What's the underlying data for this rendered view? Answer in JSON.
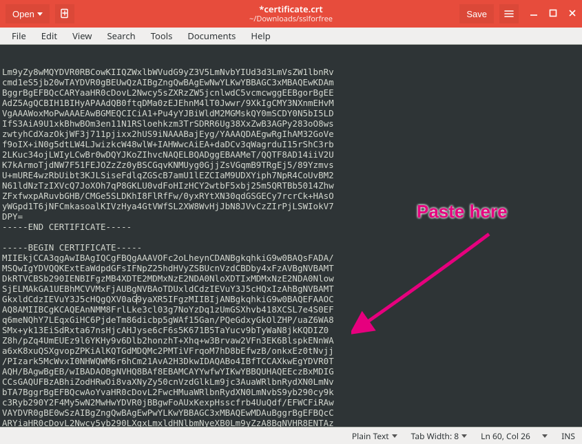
{
  "titlebar": {
    "open": "Open",
    "new_doc_title": "Create a new document",
    "save": "Save",
    "title": "*certificate.crt",
    "subtitle": "~/Downloads/sslforfree"
  },
  "menubar": {
    "file": "File",
    "edit": "Edit",
    "view": "View",
    "search": "Search",
    "tools": "Tools",
    "documents": "Documents",
    "help": "Help"
  },
  "editor": {
    "lines": [
      "Lm9yZy8wMQYDVR0RBCowKIIQZWxlbWVudG9yZ3V5LmNvbYIUd3d3LmVsZW1lbnRv",
      "cmd1eS5jb20wTAYDVR0gBEUwQzAIBgZngQwBAgEwNwYLKwYBBAGC3xMBAQEwKDAm",
      "BggrBgEFBQcCARYaaHR0cDovL2Nwcy5sZXRzZW5jcnlwdC5vcmcwggEEBgorBgEE",
      "AdZ5AgQCBIH1BIHyAPAAdQB0ftqDMa0zEJEhnM4lT0Jwwr/9XkIgCMY3NXnmEHvM",
      "VgAAAWoxMoPwAAAEAwBGMEQCICiA1+Pu4yYJBiWldM2MGMskQY0mSCDY0N5bI5LD",
      "IfS3AiA9U1xkBhwBOm3en11N1RSloehkzm3TrSDRR6Ug38XxZwB3AGPy283oO8ws",
      "zwtyhCdXazOkjWF3j711pjixx2hUS9iNAAABajEyg/YAAAQDAEgwRgIhAM32GoVe",
      "f9oIX+iN0g5dtLW4LJwizkcW48wlW+IAHWwcAiEA+daDCv3qWagrduI15rShC3rb",
      "2LKuc34ojLWIyLCwBr0wDQYJKoZIhvcNAQELBQADggEBAAMeT/QQTF8AD14iiV2U",
      "K7kArmoTjdNW7F51FEJOZzZz0yBSCGqvKNMUyg0GjjZsVGqmB9TRgEj5/89Yzmvs",
      "U+mURE4wzRbUibt3KJLSiseFdlqZGScB7amU1lEZCIaM9UDXYiph7NpR4CoUvBM2",
      "N61ldNzTzIXVcQ7JoXOh7qP8GKLU0vdFoHIzHCY2wtbF5xbj25m5QRTBb5014Zhw",
      "ZFxfwxpARuvbGHB/CMGe5SLDKhI8FlRfFw/0yxRYtXN30qdGSGECy7rcrCk+HAsO",
      "yWGpd1T6jNFCmkasoalKIVzHya4GtVWfSL2XW8WvHjJbN8JVvCzZIrPjLSWIokV7",
      "DPY=",
      "-----END CERTIFICATE-----",
      "",
      "-----BEGIN CERTIFICATE-----",
      "MIIEkjCCA3qgAwIBAgIQCgFBQgAAAVOFc2oLheynCDANBgkqhkiG9w0BAQsFADA/",
      "MSQwIgYDVQQKExtEaWdpdGFsIFNpZ25hdHVyZSBUcnVzdCBDby4xFzAVBgNVBAMT",
      "DkRTVCBSb290IENBIFgzMB4XDTE2MDMxNzE2NDA0NloXDTIxMDMxNzE2NDA0Nlow",
      "SjELMAkGA1UEBhMCVVMxFjAUBgNVBAoTDUxldCdzIEVuY3J5cHQxIzAhBgNVBAMT",
      "GkxldCdzIEVuY3J5cHQgQXV0aG9yaXR5IFgzMIIBIjANBgkqhkiG9w0BAQEFAAOC",
      "AQ8AMIIBCgKCAQEAnNMM8FrlLke3cl03g7NoYzDq1zUmGSXhvb418XCSL7e4S0EF",
      "q6meNQhY7LEqxGiHC6PjdeTm86dicbp5gWAf15Gan/PQeGdxyGkOlZHP/uaZ6WA8",
      "SMx+yk13EiSdRxta67nsHjcAHJyse6cF6s5K671B5TaYucv9bTyWaN8jkKQDIZ0",
      "Z8h/pZq4UmEUEz9l6YKHy9v6Dlb2honzhT+Xhq+w3Brvaw2VFn3EK6BlspkENnWA",
      "a6xK8xuQSXgvopZPKiAlKQTGdMDQMc2PMTiVFrqoM7hD8bEfwzB/onkxEz0tNvjj",
      "/PIzark5McWvxI0NHWQWM6r6hCm21AvA2H3DkwIDAQABo4IBfTCCAXkwEgYDVR0T",
      "AQH/BAgwBgEB/wIBADAOBgNVHQ8BAf8EBAMCAYYwfwYIKwYBBQUHAQEEczBxMDIG",
      "CCsGAQUFBzABhiZodHRwOi8vaXNyZy50cnVzdGlkLm9jc3AuaWRlbnRydXN0LmNv",
      "bTA7BggrBgEFBQcwAoYvaHR0cDovL2FwcHMuaWRlbnRydXN0LmNvbS9yb290cy9k",
      "c3Ryb290Y2F4My5wN2MwHwYDVR0jBBgwFoAUxKexpHsscfrb4UuQdf/EFWCFiRAw",
      "VAYDVR0gBE0wSzAIBgZngQwBAgEwPwYLKwYBBAGC3xMBAQEwMDAuBggrBgEFBQcC",
      "ARYiaHR0cDovL2Nwcy5yb290LXgxLmxldHNlbmNyeXB0Lm9yZzA8BgNVHR8ENTAz"
    ],
    "annotation": "Paste here"
  },
  "statusbar": {
    "syntax": "Plain Text",
    "tabwidth": "Tab Width: 8",
    "position": "Ln 60, Col 26",
    "ins_mode": "INS"
  }
}
